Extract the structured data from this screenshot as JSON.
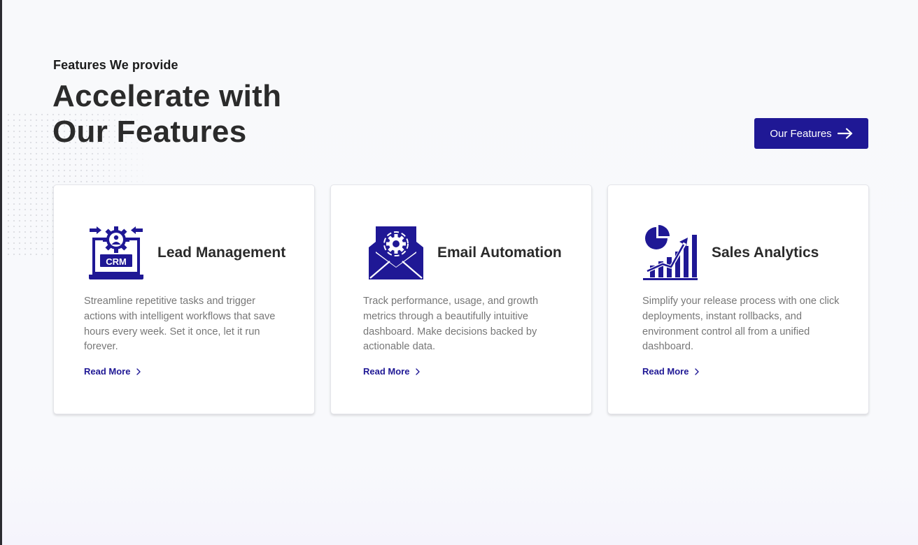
{
  "section": {
    "eyebrow": "Features We provide",
    "title_line1": "Accelerate with",
    "title_line2": "Our Features",
    "cta_label": "Our Features"
  },
  "cards": [
    {
      "icon": "crm-icon",
      "title": "Lead Management",
      "description": "Streamline repetitive tasks and trigger actions with intelligent workflows that save hours every week. Set it once, let it run forever.",
      "link_label": "Read More"
    },
    {
      "icon": "email-gear-icon",
      "title": "Email Automation",
      "description": "Track performance, usage, and growth metrics through a beautifully intuitive dashboard. Make decisions backed by actionable data.",
      "link_label": "Read More"
    },
    {
      "icon": "analytics-chart-icon",
      "title": "Sales Analytics",
      "description": "Simplify your release process with one click deployments, instant rollbacks, and environment control all from a unified dashboard.",
      "link_label": "Read More"
    }
  ],
  "colors": {
    "accent": "#1f1895",
    "background": "#f8f9fb",
    "heading": "#2b2b2b",
    "body_text": "#777777"
  }
}
